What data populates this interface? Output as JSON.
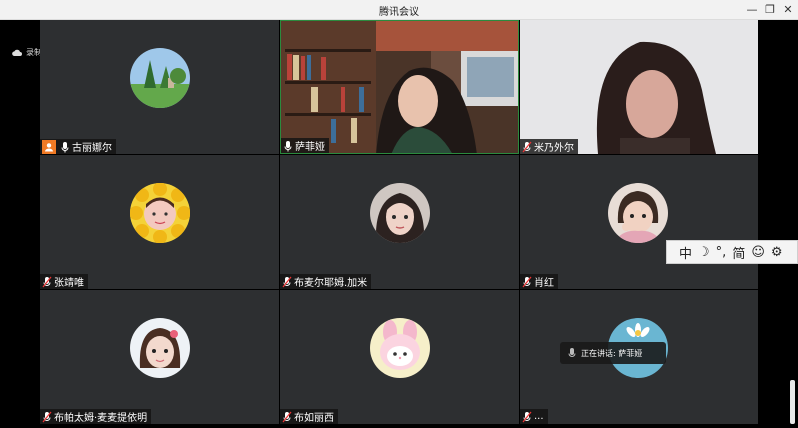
{
  "window": {
    "title": "腾讯会议",
    "minimize": "—",
    "restore": "❐",
    "close": "✕"
  },
  "recording": {
    "label": "录制中"
  },
  "participants": [
    {
      "name": "古丽娜尔",
      "host": true
    },
    {
      "name": "萨菲娅",
      "active": true
    },
    {
      "name": "米乃外尔"
    },
    {
      "name": "张靖唯"
    },
    {
      "name": "布麦尔耶姆.加米"
    },
    {
      "name": "肖红"
    },
    {
      "name": "布帕太姆·麦麦提依明"
    },
    {
      "name": "布如丽西"
    },
    {
      "name": "..."
    }
  ],
  "speaking": {
    "label": "正在讲话: 萨菲娅"
  },
  "ime_toolbar": {
    "mode": "中",
    "moon": "☽",
    "punct": "°,",
    "script": "简",
    "smile": "☺",
    "gear": "⚙"
  },
  "colors": {
    "active_border": "#2b8a3e",
    "host_badge": "#f07a25",
    "tile_bg": "#2d2f31"
  }
}
